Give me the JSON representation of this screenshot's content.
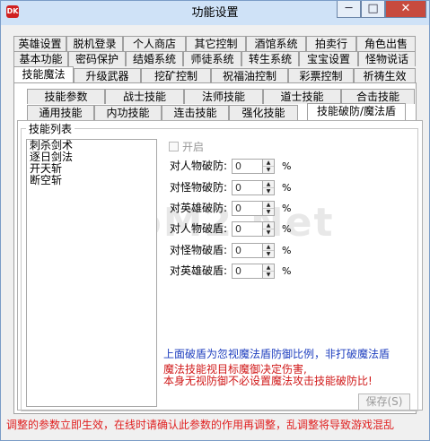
{
  "window": {
    "title": "功能设置",
    "minimize_glyph": "─",
    "maximize_glyph": "□",
    "close_glyph": "✕",
    "icon_text": "DK"
  },
  "tabs": {
    "row1": [
      "英雄设置",
      "脱机登录",
      "个人商店",
      "其它控制",
      "酒馆系统",
      "拍卖行",
      "角色出售"
    ],
    "row2": [
      "基本功能",
      "密码保护",
      "结婚系统",
      "师徒系统",
      "转生系统",
      "宝宝设置",
      "怪物说话"
    ],
    "row3": [
      "技能魔法",
      "升级武器",
      "挖矿控制",
      "祝福油控制",
      "彩票控制",
      "祈祷生效"
    ],
    "row4": [
      "技能参数",
      "战士技能",
      "法师技能",
      "道士技能",
      "合击技能"
    ],
    "row5": [
      "通用技能",
      "内功技能",
      "连击技能",
      "强化技能",
      "技能破防/魔法盾"
    ]
  },
  "skill_list": {
    "label": "技能列表",
    "items": [
      "刺杀剑术",
      "逐日剑法",
      "开天斩",
      "断空斩"
    ]
  },
  "form": {
    "enable_label": "开启",
    "rows": [
      {
        "label": "对人物破防:",
        "value": "0",
        "unit": "%"
      },
      {
        "label": "对怪物破防:",
        "value": "0",
        "unit": "%"
      },
      {
        "label": "对英雄破防:",
        "value": "0",
        "unit": "%"
      },
      {
        "label": "对人物破盾:",
        "value": "0",
        "unit": "%"
      },
      {
        "label": "对怪物破盾:",
        "value": "0",
        "unit": "%"
      },
      {
        "label": "对英雄破盾:",
        "value": "0",
        "unit": "%"
      }
    ]
  },
  "notes": {
    "blue": "上面破盾为忽视魔法盾防御比例，非打破魔法盾",
    "red_line1": "魔法技能视目标魔御决定伤害,",
    "red_line2": "本身无视防御不必设置魔法攻击技能破防比!"
  },
  "save_label": "保存(S)",
  "status_text": "调整的参数立即生效，在线时请确认此参数的作用再调整，乱调整将导致游戏混乱",
  "watermark": "HaoM2.Net"
}
